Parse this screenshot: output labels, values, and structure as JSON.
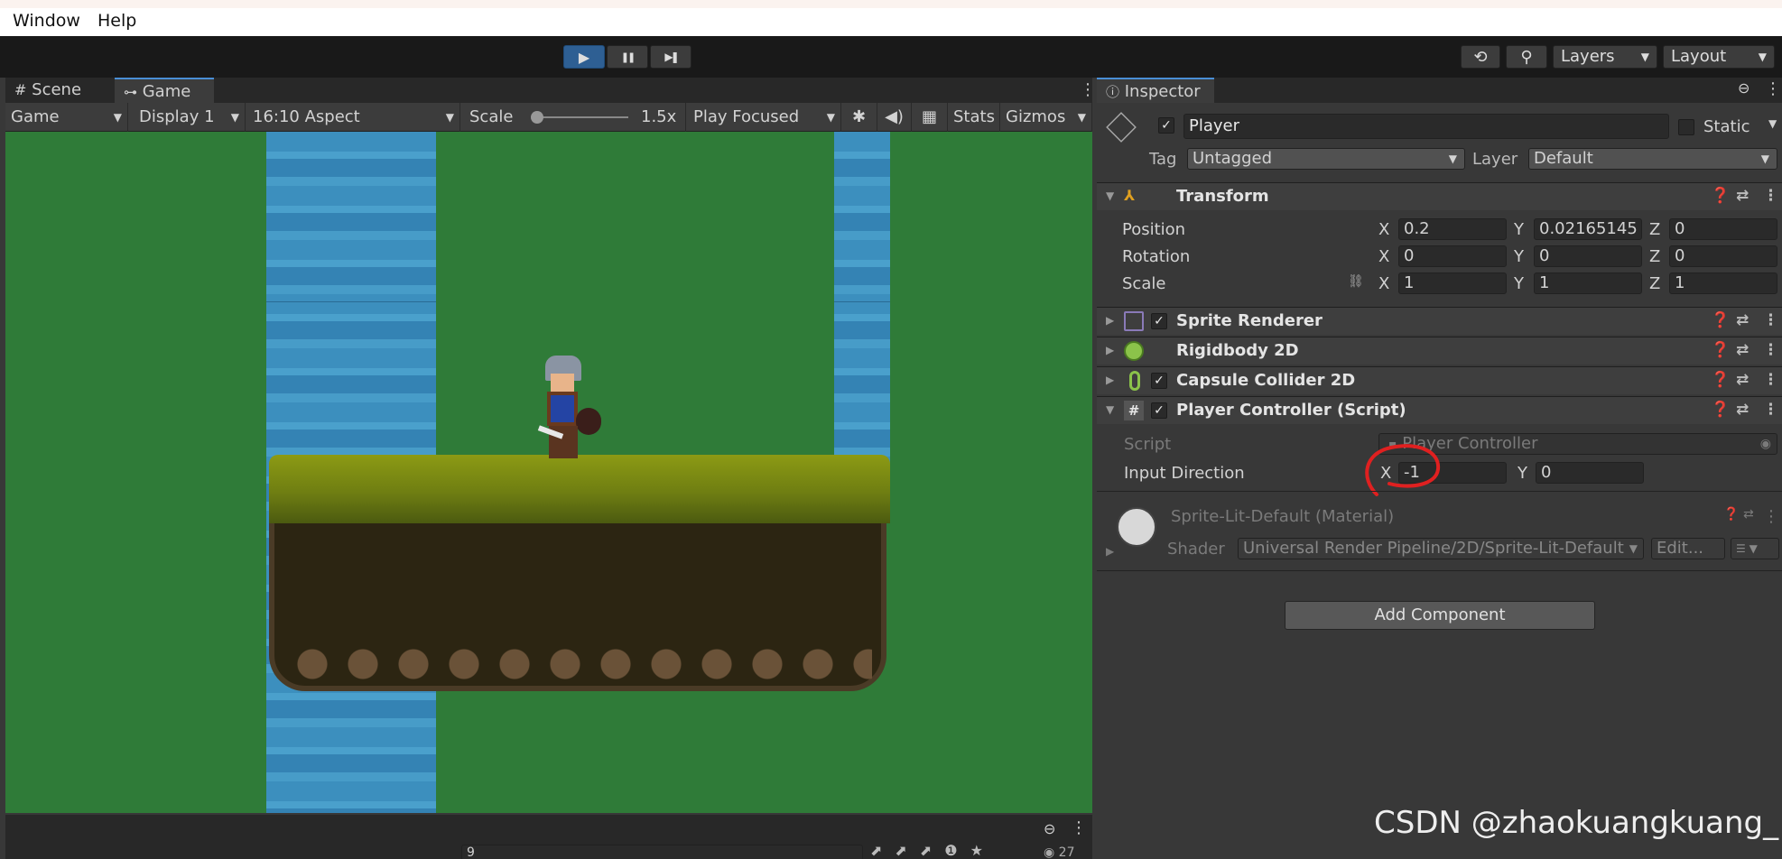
{
  "menu": {
    "items": [
      "Window",
      "Help"
    ]
  },
  "toolbar": {
    "play": "▶",
    "pause": "❚❚",
    "step": "▶❚",
    "history": "⟲",
    "search": "⚲",
    "layers": "Layers",
    "layout": "Layout"
  },
  "tabs": {
    "scene": "Scene",
    "game": "Game",
    "inspector": "Inspector"
  },
  "game_toolbar": {
    "mode": "Game",
    "display": "Display 1",
    "aspect": "16:10 Aspect",
    "scale_label": "Scale",
    "scale_value": "1.5x",
    "play_focused": "Play Focused",
    "stats": "Stats",
    "gizmos": "Gizmos"
  },
  "inspector": {
    "object_name": "Player",
    "static_label": "Static",
    "tag_label": "Tag",
    "tag_value": "Untagged",
    "layer_label": "Layer",
    "layer_value": "Default",
    "transform": {
      "title": "Transform",
      "position": {
        "label": "Position",
        "x": "0.2",
        "y": "0.02165145",
        "z": "0"
      },
      "rotation": {
        "label": "Rotation",
        "x": "0",
        "y": "0",
        "z": "0"
      },
      "scale": {
        "label": "Scale",
        "x": "1",
        "y": "1",
        "z": "1"
      }
    },
    "components": [
      "Sprite Renderer",
      "Rigidbody 2D",
      "Capsule Collider 2D",
      "Player Controller (Script)"
    ],
    "script_label": "Script",
    "script_value": "Player Controller",
    "input_direction": {
      "label": "Input Direction",
      "x": "-1",
      "y": "0"
    },
    "material": {
      "name": "Sprite-Lit-Default (Material)",
      "shader_label": "Shader",
      "shader_value": "Universal Render Pipeline/2D/Sprite-Lit-Default",
      "edit": "Edit..."
    },
    "add_component": "Add Component"
  },
  "axis": {
    "x": "X",
    "y": "Y",
    "z": "Z"
  },
  "bottom": {
    "search_value": "9",
    "count": "27"
  },
  "watermark": "CSDN @zhaokuangkuang_",
  "colors": {
    "play_active": "#2e5f93",
    "game_bg": "#2f7b38",
    "water": "#3c8fbe",
    "annotation": "#e02020"
  }
}
